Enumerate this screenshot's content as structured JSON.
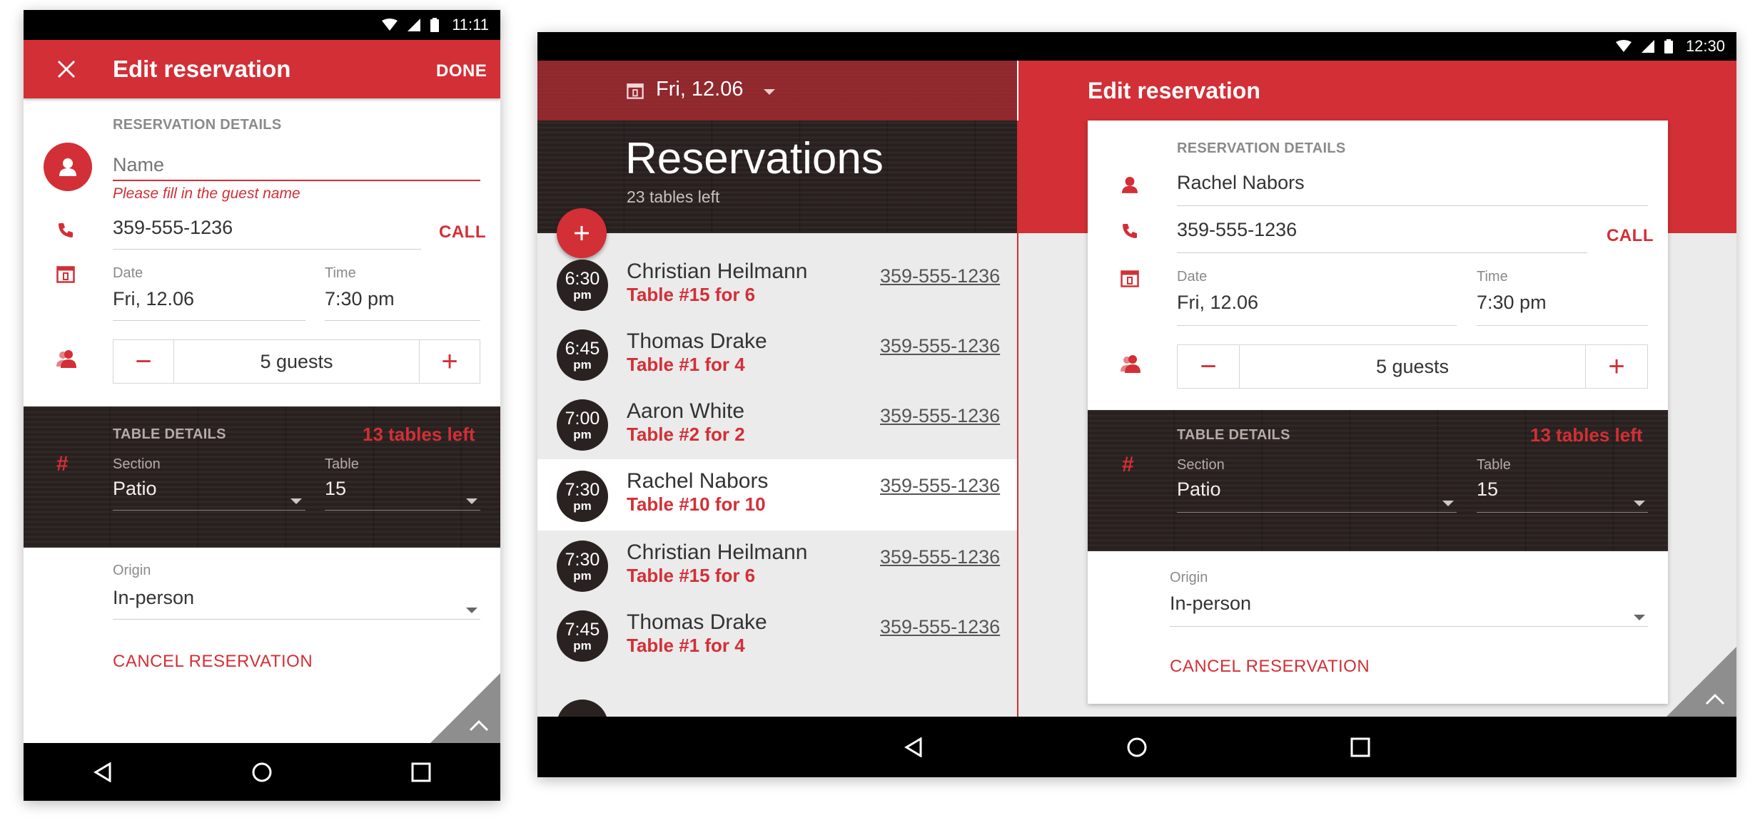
{
  "colors": {
    "accent": "#d32f36",
    "wood": "#2a2220",
    "status_bar": "#000000"
  },
  "phone": {
    "status_time": "11:11",
    "toolbar": {
      "close_icon": "close-icon",
      "title": "Edit reservation",
      "done_label": "DONE"
    },
    "reservation_details_label": "RESERVATION DETAILS",
    "name_placeholder": "Name",
    "name_error": "Please fill in the guest name",
    "phone_value": "359-555-1236",
    "call_label": "CALL",
    "date_label": "Date",
    "date_value": "Fri, 12.06",
    "time_label": "Time",
    "time_value": "7:30 pm",
    "guests_value": "5 guests",
    "table_details_label": "TABLE DETAILS",
    "tables_left": "13 tables left",
    "section_label": "Section",
    "section_value": "Patio",
    "table_label": "Table",
    "table_value": "15",
    "origin_label": "Origin",
    "origin_value": "In-person",
    "cancel_label": "CANCEL RESERVATION"
  },
  "tablet": {
    "status_time": "12:30",
    "list": {
      "date_selector": "Fri, 12.06",
      "title": "Reservations",
      "subtitle": "23 tables left",
      "items": [
        {
          "time": "6:30",
          "ampm": "pm",
          "name": "Christian Heilmann",
          "table": "Table #15 for 6",
          "phone": "359-555-1236"
        },
        {
          "time": "6:45",
          "ampm": "pm",
          "name": "Thomas Drake",
          "table": "Table #1 for 4",
          "phone": "359-555-1236"
        },
        {
          "time": "7:00",
          "ampm": "pm",
          "name": "Aaron White",
          "table": "Table #2 for 2",
          "phone": "359-555-1236"
        },
        {
          "time": "7:30",
          "ampm": "pm",
          "name": "Rachel Nabors",
          "table": "Table #10 for 10",
          "phone": "359-555-1236"
        },
        {
          "time": "7:30",
          "ampm": "pm",
          "name": "Christian Heilmann",
          "table": "Table #15 for 6",
          "phone": "359-555-1236"
        },
        {
          "time": "7:45",
          "ampm": "pm",
          "name": "Thomas Drake",
          "table": "Table #1 for 4",
          "phone": "359-555-1236"
        }
      ]
    },
    "edit": {
      "title": "Edit reservation",
      "reservation_details_label": "RESERVATION DETAILS",
      "name_value": "Rachel Nabors",
      "phone_value": "359-555-1236",
      "call_label": "CALL",
      "date_label": "Date",
      "date_value": "Fri, 12.06",
      "time_label": "Time",
      "time_value": "7:30 pm",
      "guests_value": "5 guests",
      "table_details_label": "TABLE DETAILS",
      "tables_left": "13 tables left",
      "section_label": "Section",
      "section_value": "Patio",
      "table_label": "Table",
      "table_value": "15",
      "origin_label": "Origin",
      "origin_value": "In-person",
      "cancel_label": "CANCEL RESERVATION"
    }
  }
}
